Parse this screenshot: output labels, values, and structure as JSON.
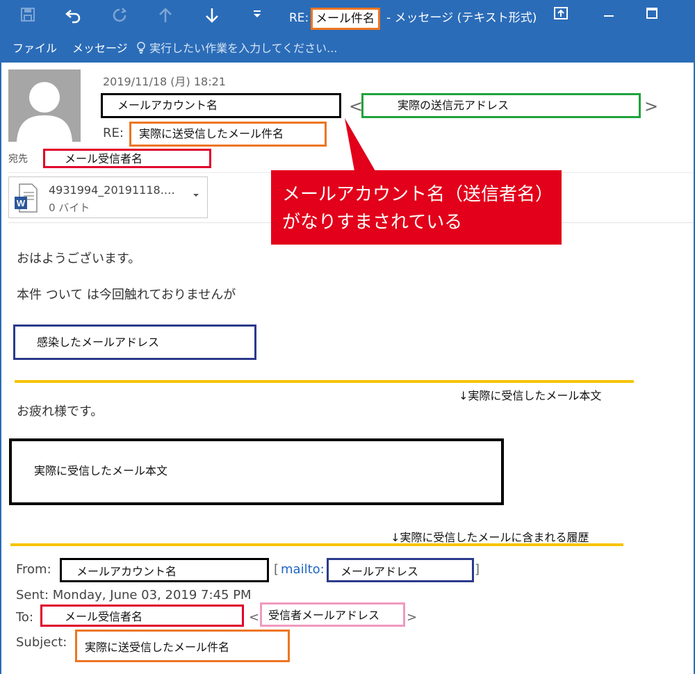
{
  "window": {
    "title_prefix": "RE:",
    "title_subject_box": "メール件名",
    "title_suffix": "- メッセージ (テキスト形式)"
  },
  "toolbar_icons": [
    "save-icon",
    "undo-icon",
    "redo-icon",
    "arrow-up-icon",
    "arrow-down-icon",
    "dropdown-icon"
  ],
  "ribbon": {
    "tabs": [
      "ファイル",
      "メッセージ"
    ],
    "tell_me": "実行したい作業を入力してください..."
  },
  "header": {
    "date": "2019/11/18 (月) 18:21",
    "sender_box": "メールアカウント名",
    "sender_open": "<",
    "sender_address_box": "実際の送信元アドレス",
    "sender_close": ">",
    "subject_prefix": "RE:",
    "subject_box": "実際に送受信したメール件名",
    "to_label": "宛先",
    "to_box": "メール受信者名"
  },
  "attachment": {
    "name": "4931994_20191118.…",
    "size": "0 バイト",
    "icon": "word-document-icon"
  },
  "callout": {
    "line1": "メールアカウント名（送信者名）",
    "line2": "がなりすまされている"
  },
  "body": {
    "greeting": "おはようございます。",
    "line2": "本件 ついて は今回触れておりませんが",
    "infected_box": "感染したメールアドレス",
    "note1": "↓実際に受信したメール本文",
    "thanks": "お疲れ様です。",
    "content_box": "実際に受信したメール本文",
    "note2": "↓実際に受信したメールに含まれる履歴"
  },
  "history": {
    "from_label": "From:",
    "from_box": "メールアカウント名",
    "from_open": "[",
    "mailto_link": "mailto:",
    "from_address_box": "メールアドレス",
    "from_close": "]",
    "sent": "Sent: Monday, June 03, 2019 7:45 PM",
    "to_label": "To:",
    "to_box": "メール受信者名",
    "to_open": "<",
    "to_address_box": "受信者メールアドレス",
    "to_close": ">",
    "subject_label": "Subject:",
    "subject_box": "実際に送受信したメール件名"
  },
  "colors": {
    "titlebar": "#2b6cb8",
    "black_box": "#000000",
    "green_box": "#1fa33c",
    "orange_box": "#ee7522",
    "red_box": "#e0002a",
    "navy_box": "#2c3a8c",
    "pink_box": "#f09ac0",
    "yellow_line": "#f5c400",
    "callout_red": "#e2001a",
    "link": "#1f66c1"
  }
}
